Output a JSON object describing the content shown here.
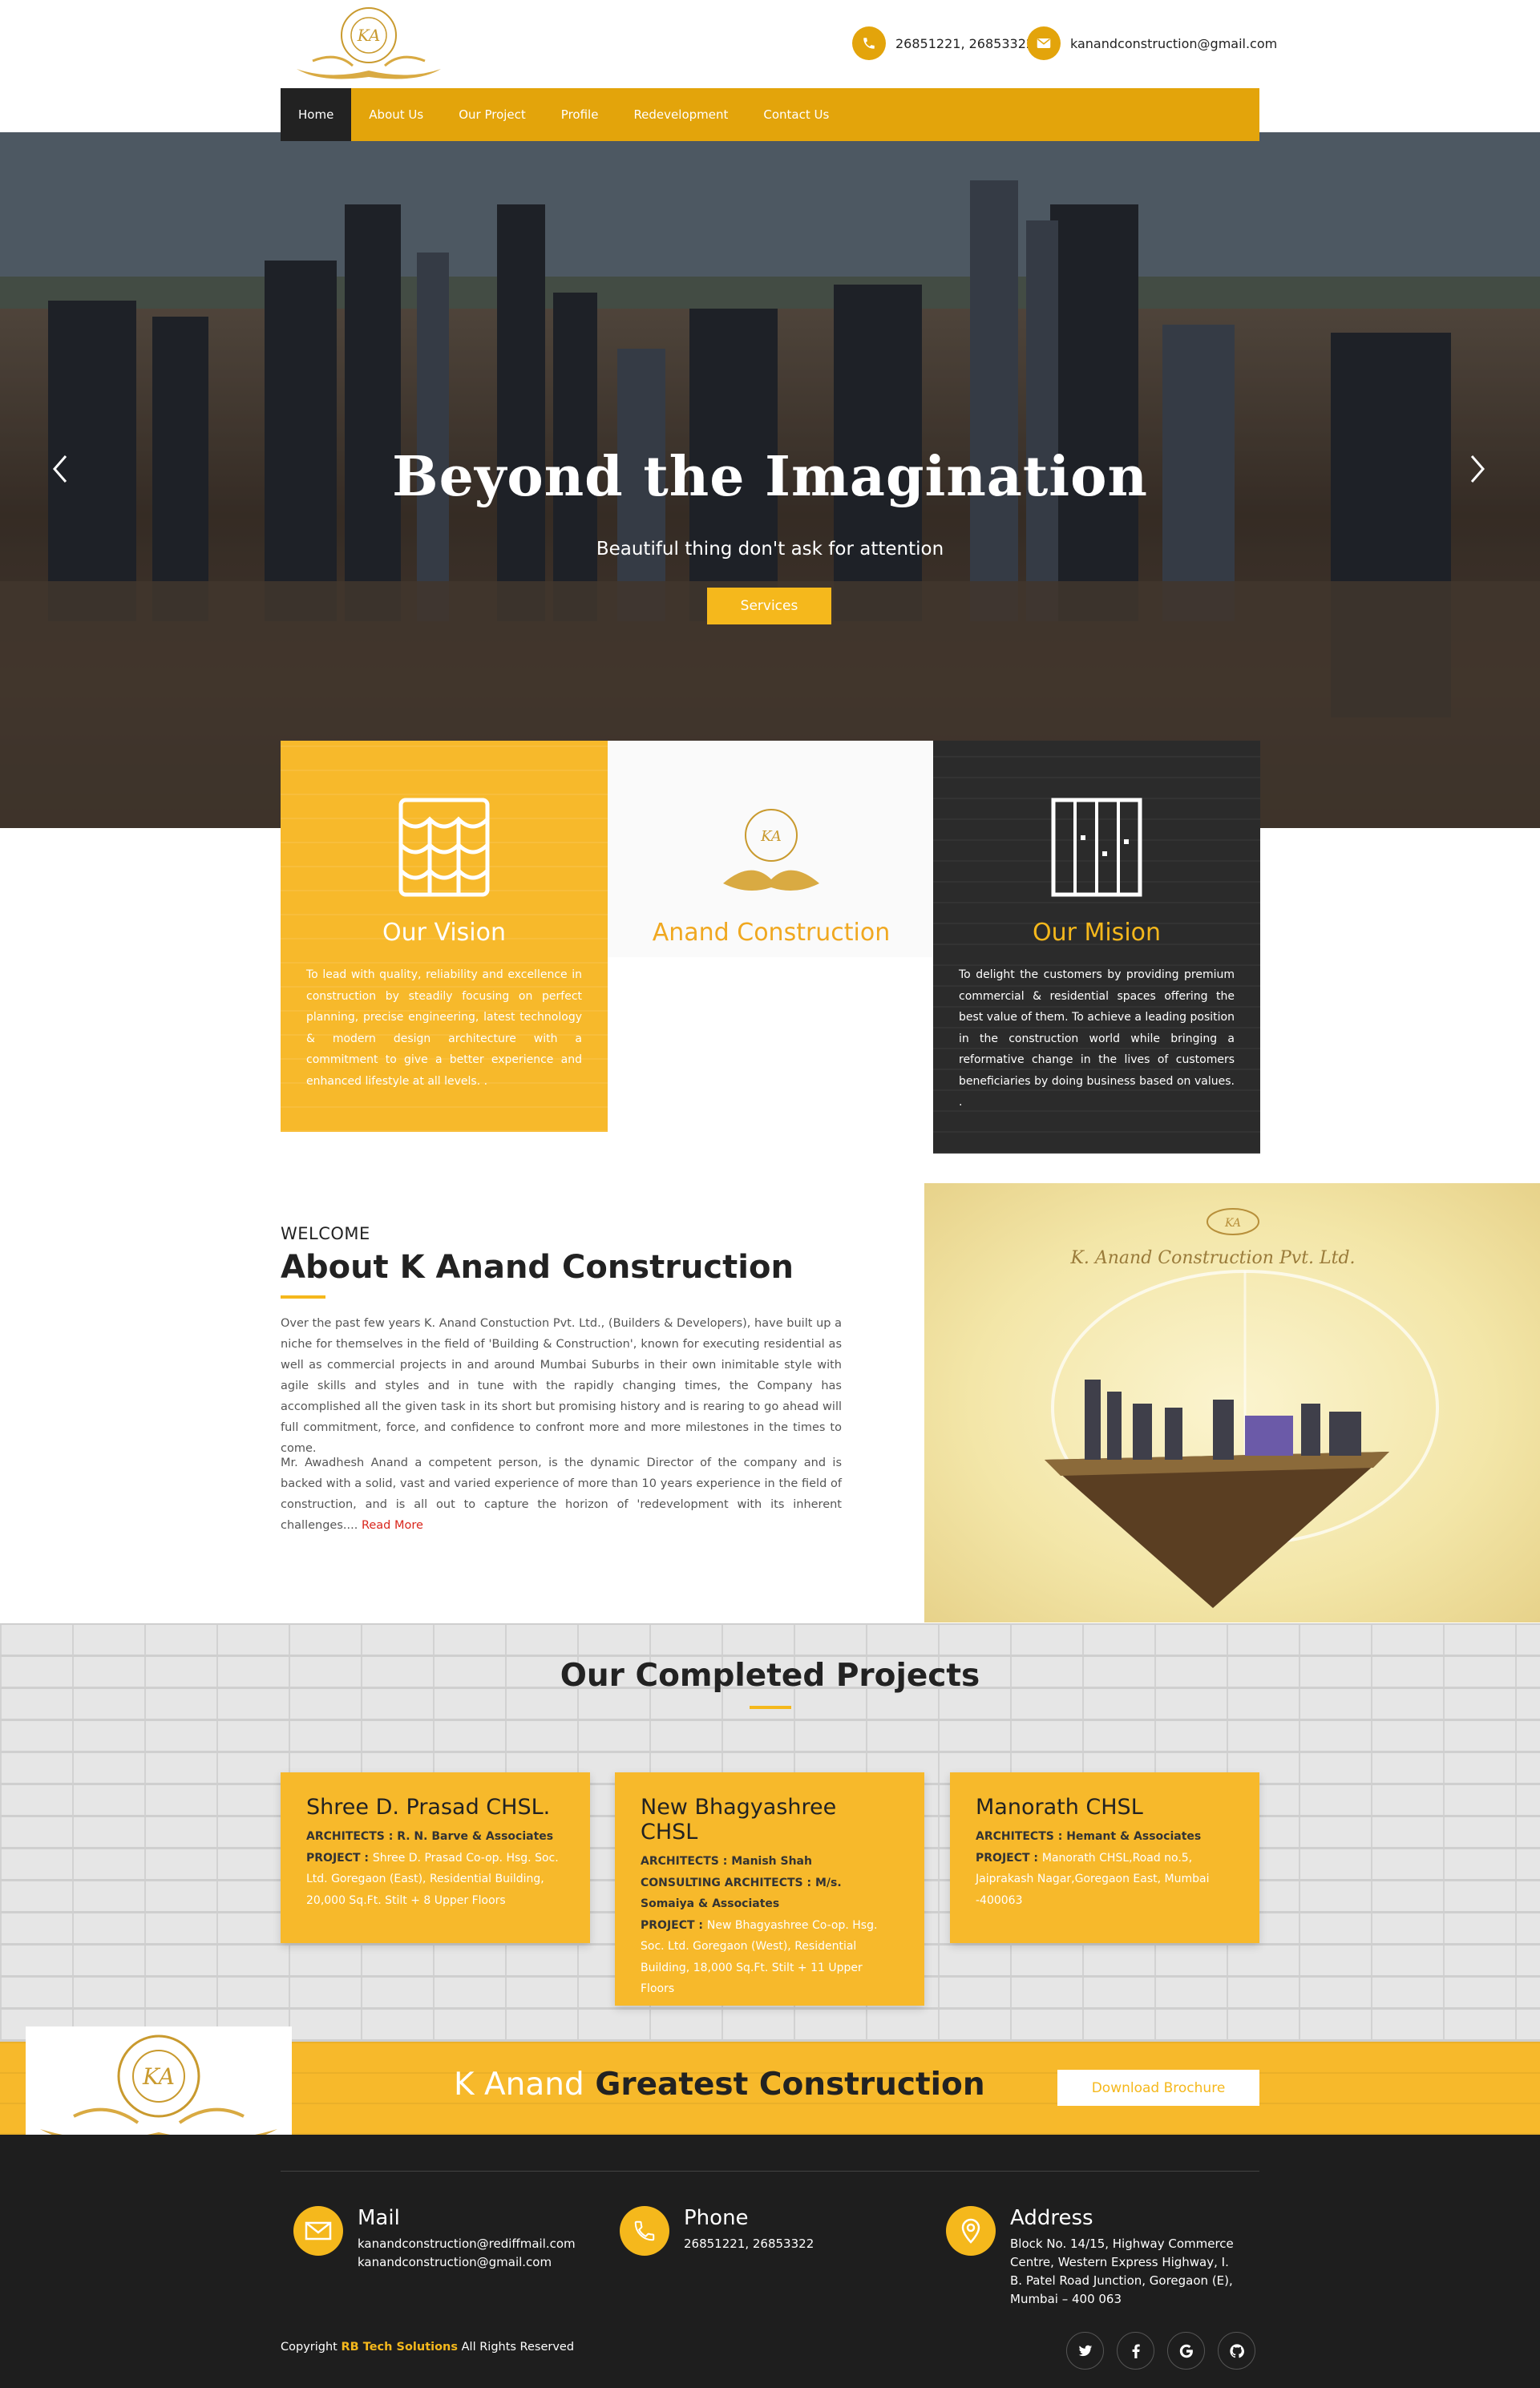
{
  "header": {
    "phone": "26851221, 26853322",
    "email": "kanandconstruction@gmail.com",
    "logo_icon": "ka-logo-we-make-property-come-true"
  },
  "nav": {
    "items": [
      {
        "label": "Home",
        "active": true
      },
      {
        "label": "About Us"
      },
      {
        "label": "Our Project"
      },
      {
        "label": "Profile"
      },
      {
        "label": "Redevelopment"
      },
      {
        "label": "Contact Us"
      }
    ]
  },
  "hero": {
    "title": "Beyond the Imagination",
    "subtitle": "Beautiful thing don't ask for attention",
    "button": "Services",
    "prev_icon": "chevron-left-icon",
    "next_icon": "chevron-right-icon"
  },
  "features": [
    {
      "title": "Our Vision",
      "text": "To lead with quality, reliability and excellence in construction by steadily focusing on perfect planning, precise engineering, latest technology & modern design architecture with a commitment to give a better experience and enhanced lifestyle at all levels. ."
    },
    {
      "title": "Anand Construction"
    },
    {
      "title": "Our Mision",
      "text": "To delight the customers by providing premium commercial & residential spaces offering the best value of them. To achieve a leading position in the construction world while bringing a reformative change in the lives of customers beneficiaries by doing business based on values. ."
    }
  ],
  "about": {
    "welcome": "WELCOME",
    "title": "About K Anand Construction",
    "p1": "Over the past few years K. Anand Constuction Pvt. Ltd., (Builders & Developers), have built up a niche for themselves in the field of 'Building & Construction', known for executing residential as well as commercial projects in and around Mumbai Suburbs in their own inimitable style with agile skills and styles and in tune with the rapidly changing times, the Company has accomplished all the given task in its short but promising history and is rearing to go ahead will full commitment, force, and confidence to confront more and more milestones in the times to come.",
    "p2": "Mr. Awadhesh Anand a competent person, is the dynamic Director of the company and is backed with a solid, vast and varied experience of more than 10 years experience in the field of construction, and is all out to capture the horizon of 'redevelopment with its inherent challenges....",
    "read_more": "Read More",
    "image_caption": "K. Anand Construction Pvt. Ltd."
  },
  "projects": {
    "title": "Our Completed Projects",
    "items": [
      {
        "name": "Shree D. Prasad CHSL.",
        "lines": [
          {
            "k": "ARCHITECTS : ",
            "v": "R. N. Barve & Associates",
            "bold": true
          },
          {
            "k": "PROJECT : ",
            "v": "Shree D. Prasad Co-op. Hsg. Soc. Ltd. Goregaon (East), Residential Building, 20,000 Sq.Ft. Stilt + 8 Upper Floors"
          }
        ]
      },
      {
        "name": "New Bhagyashree CHSL",
        "lines": [
          {
            "k": "ARCHITECTS : ",
            "v": "Manish Shah",
            "bold": true
          },
          {
            "k": "CONSULTING ARCHITECTS : ",
            "v": "M/s. Somaiya & Associates",
            "bold": true
          },
          {
            "k": "PROJECT : ",
            "v": "New Bhagyashree Co-op. Hsg. Soc. Ltd. Goregaon (West), Residential Building, 18,000 Sq.Ft. Stilt + 11 Upper Floors"
          }
        ]
      },
      {
        "name": "Manorath CHSL",
        "lines": [
          {
            "k": "ARCHITECTS : ",
            "v": "Hemant & Associates",
            "bold": true
          },
          {
            "k": "PROJECT : ",
            "v": "Manorath CHSL,Road no.5, Jaiprakash Nagar,Goregaon East, Mumbai -400063"
          }
        ]
      }
    ]
  },
  "banner": {
    "text_white": "K Anand",
    "text_dark": "Greatest Construction",
    "button": "Download Brochure"
  },
  "footer": {
    "mail_title": "Mail",
    "mail_1": "kanandconstruction@rediffmail.com",
    "mail_2": "kanandconstruction@gmail.com",
    "phone_title": "Phone",
    "phone": "26851221, 26853322",
    "address_title": "Address",
    "address": "Block No. 14/15, Highway Commerce Centre, Western Express Highway, I. B. Patel Road Junction, Goregaon (E), Mumbai – 400 063",
    "copyright_pre": "Copyright",
    "copyright_link": "RB Tech Solutions",
    "copyright_post": "All Rights Reserved",
    "social": [
      "twitter-icon",
      "facebook-icon",
      "google-icon",
      "github-icon"
    ]
  },
  "colors": {
    "accent": "#f5b81c",
    "dark": "#1e1e1e",
    "nav": "#e3a40b"
  }
}
